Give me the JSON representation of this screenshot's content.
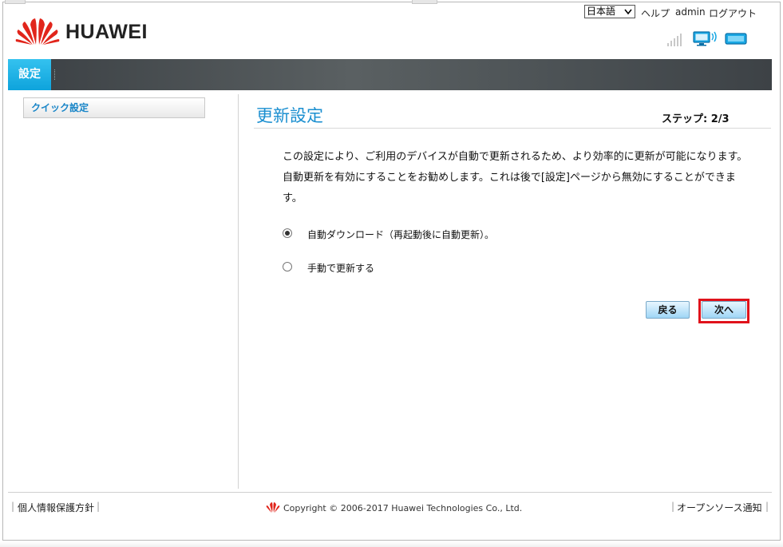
{
  "header": {
    "brand": "HUAWEI",
    "language_selected": "日本語",
    "help_label": "ヘルプ",
    "user_label": "admin",
    "logout_label": "ログアウト"
  },
  "nav": {
    "active_tab": "設定"
  },
  "sidebar": {
    "items": [
      {
        "label": "クイック設定"
      }
    ]
  },
  "main": {
    "title": "更新設定",
    "step": "ステップ: 2/3",
    "description": "この設定により、ご利用のデバイスが自動で更新されるため、より効率的に更新が可能になります。自動更新を有効にすることをお勧めします。これは後で[設定]ページから無効にすることができます。",
    "options": [
      {
        "label": "自動ダウンロード（再起動後に自動更新）。",
        "selected": true
      },
      {
        "label": "手動で更新する",
        "selected": false
      }
    ],
    "back_button": "戻る",
    "next_button": "次へ"
  },
  "footer": {
    "privacy_link": "個人情報保護方針",
    "copyright": "Copyright © 2006-2017 Huawei Technologies Co., Ltd.",
    "opensource_link": "オープンソース通知"
  },
  "colors": {
    "accent": "#1b8fd0",
    "nav_active": "#1aaee6",
    "highlight": "#e0121b",
    "brand_red": "#e1251b"
  },
  "icons": [
    "huawei-logo",
    "signal-icon",
    "monitor-icon",
    "battery-icon",
    "radio-selected",
    "radio-unselected"
  ]
}
